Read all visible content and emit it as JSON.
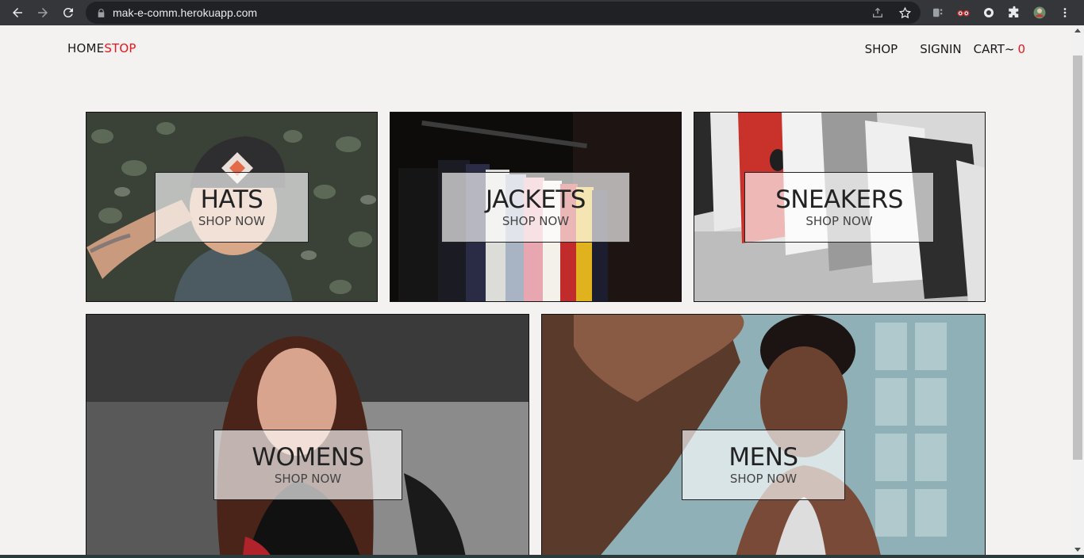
{
  "browser": {
    "url": "mak-e-comm.herokuapp.com",
    "icons": [
      "back-icon",
      "forward-icon",
      "reload-icon",
      "lock-icon",
      "share-icon",
      "star-icon",
      "extension-icon",
      "puzzle-icon",
      "profile-avatar",
      "menu-icon"
    ]
  },
  "header": {
    "logo_part1": "HOME",
    "logo_part2": "STOP",
    "nav": {
      "shop": "SHOP",
      "signin": "SIGNIN",
      "cart": "CART~",
      "cart_count": "0"
    }
  },
  "categories": [
    {
      "title": "HATS",
      "cta": "SHOP NOW"
    },
    {
      "title": "JACKETS",
      "cta": "SHOP NOW"
    },
    {
      "title": "SNEAKERS",
      "cta": "SHOP NOW"
    },
    {
      "title": "WOMENS",
      "cta": "SHOP NOW"
    },
    {
      "title": "MENS",
      "cta": "SHOP NOW"
    }
  ],
  "colors": {
    "accent": "#e8161e",
    "page_bg": "#f4f1f1",
    "chrome_bg": "#35363a"
  }
}
